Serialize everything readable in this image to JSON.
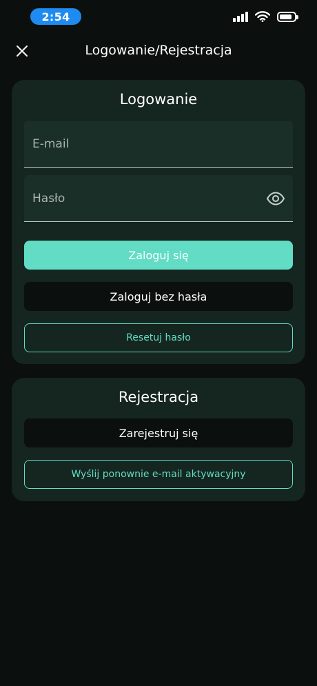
{
  "status_bar": {
    "time": "2:54",
    "signal_icon": "cellular-signal-icon",
    "wifi_icon": "wifi-icon",
    "battery_icon": "battery-icon",
    "battery_level": 0.85
  },
  "header": {
    "close_icon": "close-icon",
    "title": "Logowanie/Rejestracja"
  },
  "login": {
    "title": "Logowanie",
    "email_placeholder": "E-mail",
    "email_value": "",
    "password_placeholder": "Hasło",
    "password_value": "",
    "show_password_icon": "eye-icon",
    "login_button": "Zaloguj się",
    "passwordless_button": "Zaloguj bez hasła",
    "reset_button": "Resetuj hasło"
  },
  "register": {
    "title": "Rejestracja",
    "register_button": "Zarejestruj się",
    "resend_button": "Wyślij ponownie e-mail aktywacyjny"
  },
  "colors": {
    "background": "#0b0f0e",
    "card": "#15251f",
    "field": "#1b2f29",
    "accent": "#62dcc4",
    "status_time_pill": "#1e8bf0"
  }
}
